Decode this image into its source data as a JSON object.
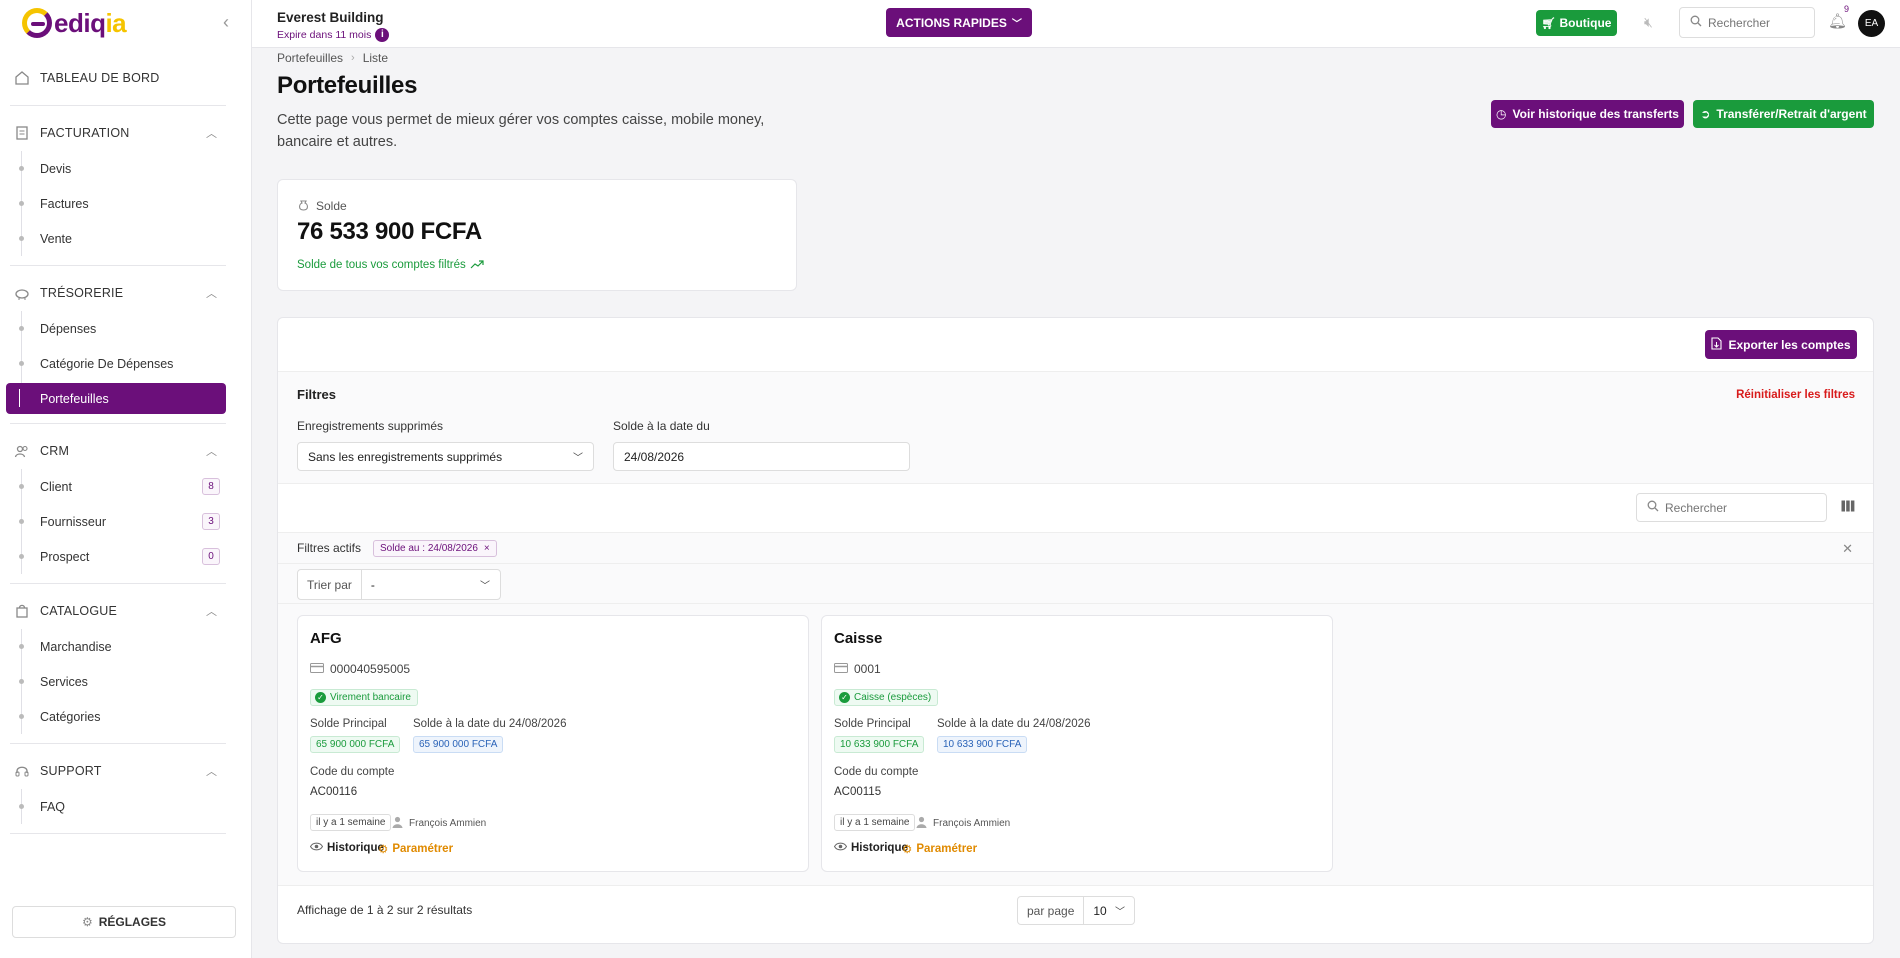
{
  "brand": {
    "logo_text_main": "ediq",
    "logo_text_accent": "ia"
  },
  "sidebar": {
    "sections": [
      {
        "id": "dashboard",
        "label": "TABLEAU DE BORD",
        "icon": "home-icon"
      },
      {
        "id": "billing",
        "label": "FACTURATION",
        "icon": "invoice-icon",
        "items": [
          {
            "label": "Devis"
          },
          {
            "label": "Factures"
          },
          {
            "label": "Vente"
          }
        ]
      },
      {
        "id": "treasury",
        "label": "TRÉSORERIE",
        "icon": "piggy-bank-icon",
        "items": [
          {
            "label": "Dépenses"
          },
          {
            "label": "Catégorie De Dépenses"
          },
          {
            "label": "Portefeuilles"
          }
        ]
      },
      {
        "id": "crm",
        "label": "CRM",
        "icon": "users-icon",
        "items": [
          {
            "label": "Client",
            "count": "8"
          },
          {
            "label": "Fournisseur",
            "count": "3"
          },
          {
            "label": "Prospect",
            "count": "0"
          }
        ]
      },
      {
        "id": "catalog",
        "label": "CATALOGUE",
        "icon": "shopping-bag-icon",
        "items": [
          {
            "label": "Marchandise"
          },
          {
            "label": "Services"
          },
          {
            "label": "Catégories"
          }
        ]
      },
      {
        "id": "support",
        "label": "SUPPORT",
        "icon": "headset-icon",
        "items": [
          {
            "label": "FAQ"
          }
        ]
      }
    ],
    "active_item": "Portefeuilles",
    "settings_label": "RÉGLAGES"
  },
  "topbar": {
    "company_name": "Everest Building",
    "expiry": "Expire dans 11 mois",
    "quick_actions": "ACTIONS RAPIDES",
    "boutique": "Boutique",
    "search_placeholder": "Rechercher",
    "notif_count": "9",
    "avatar_initials": "EA"
  },
  "page": {
    "breadcrumb": [
      "Portefeuilles",
      "Liste"
    ],
    "title": "Portefeuilles",
    "description": "Cette page vous permet de mieux gérer vos comptes caisse, mobile money, bancaire et autres.",
    "btn_history": "Voir historique des transferts",
    "btn_transfer": "Transférer/Retrait d'argent"
  },
  "balance": {
    "label": "Solde",
    "value": "76 533 900 FCFA",
    "subtitle": "Solde de tous vos comptes filtrés"
  },
  "panel": {
    "export_label": "Exporter les comptes",
    "filters_title": "Filtres",
    "reset_label": "Réinitialiser les filtres",
    "filter_deleted_label": "Enregistrements supprimés",
    "filter_deleted_value": "Sans les enregistrements supprimés",
    "filter_date_label": "Solde à la date du",
    "filter_date_value": "24/08/2026",
    "search_placeholder": "Rechercher",
    "active_filters_label": "Filtres actifs",
    "active_filter_chip": "Solde au : 24/08/2026",
    "sort_label": "Trier par",
    "sort_value": "-",
    "pagination_text": "Affichage de 1 à 2 sur 2 résultats",
    "per_page_label": "par page",
    "per_page_value": "10"
  },
  "accounts": [
    {
      "name": "AFG",
      "number": "000040595005",
      "type": "Virement bancaire",
      "main_balance_label": "Solde Principal",
      "main_balance": "65 900 000 FCFA",
      "date_balance_label": "Solde à la date du 24/08/2026",
      "date_balance": "65 900 000 FCFA",
      "code_label": "Code du compte",
      "code": "AC00116",
      "time": "il y a 1 semaine",
      "user": "François Ammien",
      "history_label": "Historique",
      "settings_label": "Paramétrer"
    },
    {
      "name": "Caisse",
      "number": "0001",
      "type": "Caisse (espèces)",
      "main_balance_label": "Solde Principal",
      "main_balance": "10 633 900 FCFA",
      "date_balance_label": "Solde à la date du 24/08/2026",
      "date_balance": "10 633 900 FCFA",
      "code_label": "Code du compte",
      "code": "AC00115",
      "time": "il y a 1 semaine",
      "user": "François Ammien",
      "history_label": "Historique",
      "settings_label": "Paramétrer"
    }
  ],
  "colors": {
    "brand_purple": "#6b0f7a",
    "brand_yellow": "#f5c400",
    "success_green": "#1a9b3c",
    "danger_red": "#d81b1b",
    "warning_orange": "#e08a00"
  }
}
